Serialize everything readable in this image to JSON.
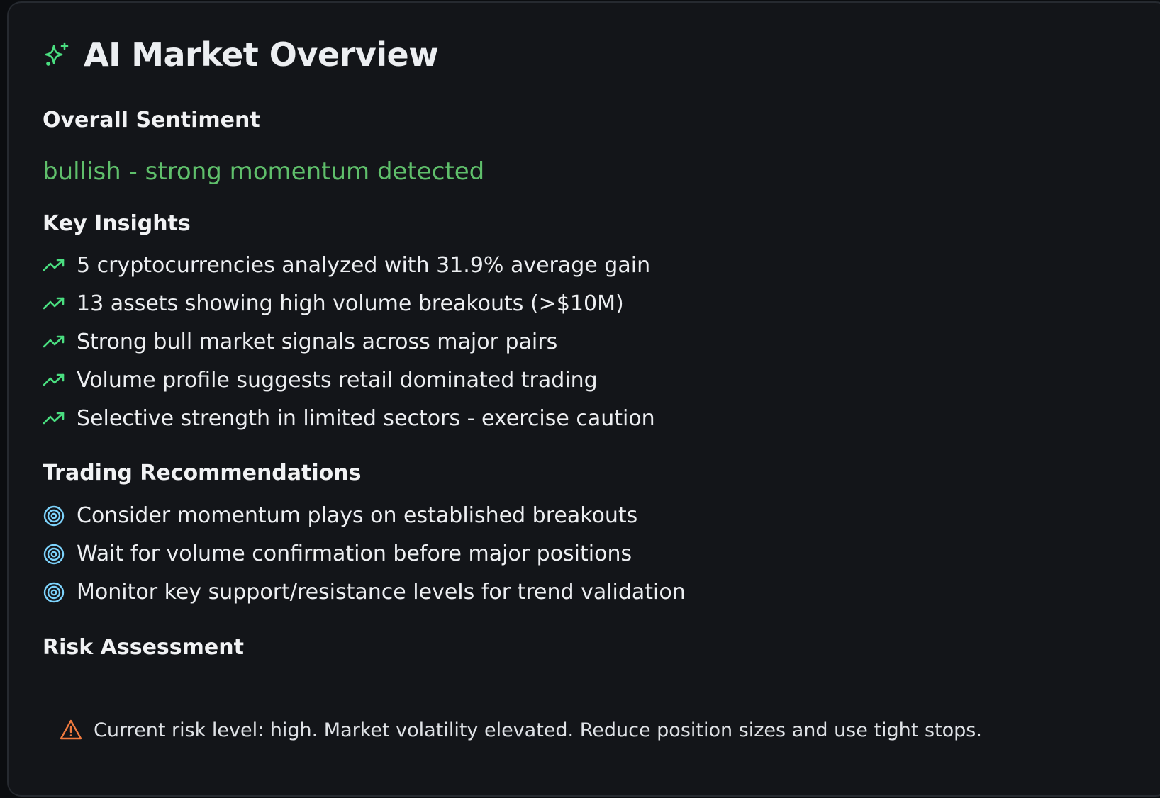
{
  "header": {
    "title": "AI Market Overview",
    "icon": "sparkles-icon"
  },
  "sentiment": {
    "heading": "Overall Sentiment",
    "value": "bullish - strong momentum detected",
    "color": "#5fbf6b"
  },
  "insights": {
    "heading": "Key Insights",
    "icon": "trending-up-icon",
    "items": [
      "5 cryptocurrencies analyzed with 31.9% average gain",
      "13 assets showing high volume breakouts (>$10M)",
      "Strong bull market signals across major pairs",
      "Volume profile suggests retail dominated trading",
      "Selective strength in limited sectors - exercise caution"
    ]
  },
  "recommendations": {
    "heading": "Trading Recommendations",
    "icon": "target-icon",
    "items": [
      "Consider momentum plays on established breakouts",
      "Wait for volume confirmation before major positions",
      "Monitor key support/resistance levels for trend validation"
    ]
  },
  "risk": {
    "heading": "Risk Assessment",
    "icon": "warning-icon",
    "text": "Current risk level: high. Market volatility elevated. Reduce position sizes and use tight stops."
  },
  "colors": {
    "accent_green": "#4ade80",
    "accent_blue": "#7dd3fc",
    "warning_orange": "#f07b3f"
  }
}
